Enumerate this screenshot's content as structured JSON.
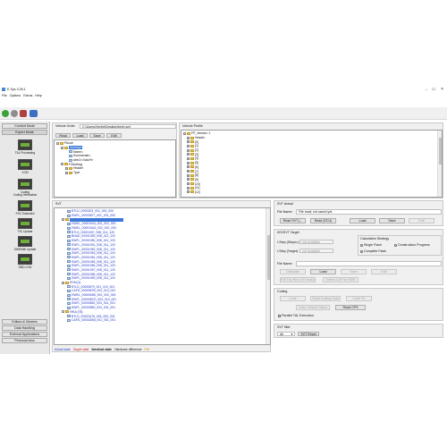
{
  "app": {
    "title": "E-Sys 3.28.1"
  },
  "menu": [
    "File",
    "Options",
    "Extras",
    "Help"
  ],
  "sidebar": {
    "top_buttons": [
      "Comfort Mode",
      "Expert Mode"
    ],
    "tools": [
      "TAL Processing",
      "VCM",
      "Coding",
      "Coding Verification",
      "FSC Extended",
      "TSL Update",
      "SWEMMI Update",
      "OBD-CVN"
    ],
    "bottom_buttons": [
      "Editors & Viewers",
      "Data Handling",
      "External Applications",
      "Personal view"
    ]
  },
  "vehicle_order": {
    "label": "Vehicle Order",
    "path": "C:\\Users\\Xenfot\\Desktop\\bmh.xml",
    "buttons": [
      "Read",
      "Load",
      "Save",
      "Edit"
    ],
    "tree": [
      {
        "text": "FAsub",
        "indent": 0,
        "pm": "-",
        "icon": "folder"
      },
      {
        "text": "Xnexeye",
        "indent": 1,
        "pm": "-",
        "icon": "folder",
        "blue": true
      },
      {
        "text": "Name=",
        "indent": 2,
        "pm": "",
        "icon": "doc"
      },
      {
        "text": "Kommentar=",
        "indent": 2,
        "pm": "",
        "icon": "doc"
      },
      {
        "text": "abeCr=SaluFe",
        "indent": 2,
        "pm": "",
        "icon": "doc"
      },
      {
        "text": "FZAuftrag",
        "indent": 1,
        "pm": "-",
        "icon": "folder"
      },
      {
        "text": "Header",
        "indent": 2,
        "pm": "+",
        "icon": "folder"
      },
      {
        "text": "Type",
        "indent": 2,
        "pm": "+",
        "icon": "folder"
      }
    ]
  },
  "vehicle_profile": {
    "label": "Vehicle Profile",
    "tree": [
      "FP_Version: 1",
      "Header",
      "[0]",
      "[1]",
      "[2]",
      "[3]",
      "[4]",
      "[5]",
      "[6]",
      "[7]",
      "[8]",
      "[9]",
      "[10]",
      "[11]",
      "[12]"
    ]
  },
  "svt_panel": {
    "label": "SVT",
    "tree": [
      {
        "text": "BTLD_00003D3_001_000_000",
        "indent": 2,
        "icon": "doc"
      },
      {
        "text": "SWFL_00003877_001_001_000",
        "indent": 2,
        "icon": "doc"
      },
      {
        "text": "",
        "indent": 1,
        "icon": "folder",
        "selected": true
      },
      {
        "text": "HWEL_00001044_002_002_000",
        "indent": 2,
        "icon": "doc"
      },
      {
        "text": "HWEL_000010A3_002_002_000",
        "indent": 2,
        "icon": "doc"
      },
      {
        "text": "BTLD_00001007_008_011_120",
        "indent": 2,
        "icon": "doc"
      },
      {
        "text": "BNAD_00001059_008_011_120",
        "indent": 2,
        "icon": "doc"
      },
      {
        "text": "SWFL_00001050_008_011_120",
        "indent": 2,
        "icon": "doc"
      },
      {
        "text": "SWFL_00001051_008_011_120",
        "indent": 2,
        "icon": "doc"
      },
      {
        "text": "SWFL_00001052_008_011_120",
        "indent": 2,
        "icon": "doc"
      },
      {
        "text": "SWFL_00001053_008_011_120",
        "indent": 2,
        "icon": "doc"
      },
      {
        "text": "SWFL_00001054_008_011_120",
        "indent": 2,
        "icon": "doc"
      },
      {
        "text": "SWFL_00001055_008_011_120",
        "indent": 2,
        "icon": "doc"
      },
      {
        "text": "SWFL_00001056_008_011_120",
        "indent": 2,
        "icon": "doc"
      },
      {
        "text": "SWFL_00001057_008_011_120",
        "indent": 2,
        "icon": "doc"
      },
      {
        "text": "SWFL_00001058_008_011_120",
        "indent": 2,
        "icon": "doc"
      },
      {
        "text": "SWFL_00001059_008_011_120",
        "indent": 2,
        "icon": "doc"
      },
      {
        "text": "EDM [1]",
        "indent": 1,
        "icon": "folder"
      },
      {
        "text": "BTLD_00000879_001_010_001",
        "indent": 2,
        "icon": "doc"
      },
      {
        "text": "CAFD_0000087B_002_014_002",
        "indent": 2,
        "icon": "doc"
      },
      {
        "text": "HWEL_00000658_002_002_000",
        "indent": 2,
        "icon": "doc"
      },
      {
        "text": "SWFL_000008CD_003_010_001",
        "indent": 2,
        "icon": "doc"
      },
      {
        "text": "SWFL_00000852_003_001_001",
        "indent": 2,
        "icon": "doc"
      },
      {
        "text": "SWFL_00000853_003_001_001",
        "indent": 2,
        "icon": "doc"
      },
      {
        "text": "IHKA [78]",
        "indent": 1,
        "icon": "folder"
      },
      {
        "text": "BTLD_00002A76_004_000_001",
        "indent": 2,
        "icon": "doc"
      },
      {
        "text": "CAFD_000032B8_001_001_001",
        "indent": 2,
        "icon": "doc"
      }
    ],
    "legend": [
      {
        "text": "Actual state",
        "color": "#2137c8"
      },
      {
        "text": "Target state",
        "color": "#c81e1e"
      },
      {
        "text": "Identical state",
        "color": "#111111"
      },
      {
        "text": "Hardware difference",
        "color": "#111111"
      },
      {
        "text": "FIN",
        "color": "#d88a00"
      }
    ]
  },
  "svt_actual": {
    "label": "SVT Actual",
    "file_name_label": "File Name:",
    "file_name_value": "File read; not saved yet.",
    "buttons": [
      "Read SVT (...",
      "Read (ECU)",
      "Load",
      "Save",
      "Edit"
    ]
  },
  "kis_svt": {
    "label": "KIS/SVT Target",
    "step1_label": "I-Step (Shipm.):",
    "step1_value": "not available",
    "step2_label": "I-Step (Target):",
    "step2_value": "not available",
    "strategy_label": "Calculation Strategy",
    "strategy_options": [
      "Single Flash",
      "Construction Progress",
      "Complete Flash"
    ],
    "strategy_selected": "Complete Flash",
    "file_name_label": "File Name:",
    "buttons_row1": [
      "Calculate",
      "Load",
      "Save",
      "Edit"
    ],
    "buttons_row2": [
      "KIS Dry Run (VO must)",
      "Detect CAF for SWE"
    ]
  },
  "coding": {
    "label": "Coding",
    "buttons_row1": [
      "Code",
      "Read Coding Data",
      "Code FA"
    ],
    "buttons_row2": [
      "Code Default Values",
      "Read CPS"
    ],
    "checkbox_label": "Parallel TAL Execution"
  },
  "svt_filter": {
    "label": "SVT filter",
    "select_value": "All",
    "reset_button": "SVT Reset"
  }
}
